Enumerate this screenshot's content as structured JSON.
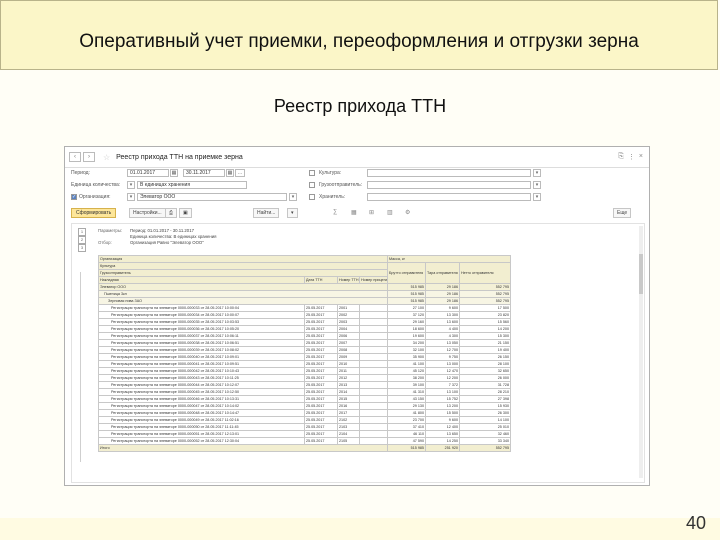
{
  "slide": {
    "title": "Оперативный учет приемки, переоформления и отгрузки зерна",
    "subtitle": "Реестр прихода ТТН",
    "page_number": "40"
  },
  "window": {
    "title": "Реестр прихода ТТН на приемке зерна"
  },
  "filters": {
    "period_label": "Период:",
    "date_from": "01.01.2017",
    "date_to": "30.11.2017",
    "units_label": "Единица количества:",
    "units_value": "В единицах хранения",
    "org_label": "Организация:",
    "org_value": "Элеватор ООО",
    "crop_label": "Культура:",
    "consignor_label": "Грузоотправитель:",
    "owner_label": "Хранитель:"
  },
  "toolbar": {
    "form_button": "Сформировать",
    "variant_button": "Настройки...",
    "find_button": "Найти...",
    "more_button": "Еще"
  },
  "report": {
    "params": [
      {
        "k": "Параметры:",
        "v": "Период: 01.01.2017 - 30.11.2017"
      },
      {
        "k": "",
        "v": "Единица количества: В единицах хранения"
      },
      {
        "k": "Отбор:",
        "v": "Организация Равно \"Элеватор ООО\""
      }
    ],
    "headers": {
      "h1": "Организация",
      "h2": "Культура",
      "h3": "Грузоотправитель",
      "h4": "Накладная",
      "date": "Дата ТТН",
      "num": "Номер ТТН",
      "num2": "Номер прицепа",
      "mass_group": "Масса, кг",
      "gross": "Брутто отправителя",
      "tare": "Тара отправителя",
      "net": "Нетто отправителя"
    },
    "groups": [
      {
        "label": "Элеватор ООО",
        "gross": "515 985",
        "tare": "29 186",
        "net": "552 795"
      },
      {
        "label": "Пшеница 3кл",
        "gross": "515 985",
        "tare": "29 186",
        "net": "552 795"
      },
      {
        "label": "Зерновая нива ЗАО",
        "gross": "515 985",
        "tare": "29 186",
        "net": "552 795"
      }
    ],
    "rows": [
      {
        "doc": "Регистрация транспорта на элеваторе 0000-000033 от 28.05.2017 10:00:04",
        "date": "25.05.2017",
        "num": "2001",
        "gross": "27 100",
        "tare": "9 600",
        "net": "17 500"
      },
      {
        "doc": "Регистрация транспорта на элеваторе 0000-000034 от 28.05.2017 10:00:07",
        "date": "25.05.2017",
        "num": "2002",
        "gross": "37 120",
        "tare": "13 300",
        "net": "23 820"
      },
      {
        "doc": "Регистрация транспорта на элеваторе 0000-000035 от 28.05.2017 10:03:53",
        "date": "25.05.2017",
        "num": "2003",
        "gross": "29 160",
        "tare": "13 600",
        "net": "15 560"
      },
      {
        "doc": "Регистрация транспорта на элеваторе 0000-000036 от 28.05.2017 10:05:20",
        "date": "25.05.2017",
        "num": "2004",
        "gross": "18 600",
        "tare": "4 400",
        "net": "14 200"
      },
      {
        "doc": "Регистрация транспорта на элеваторе 0000-000037 от 28.05.2017 10:06:11",
        "date": "25.05.2017",
        "num": "2006",
        "gross": "19 600",
        "tare": "4 300",
        "net": "15 300"
      },
      {
        "doc": "Регистрация транспорта на элеваторе 0000-000038 от 28.05.2017 10:06:51",
        "date": "25.05.2017",
        "num": "2007",
        "gross": "34 200",
        "tare": "13 050",
        "net": "21 150"
      },
      {
        "doc": "Регистрация транспорта на элеваторе 0000-000039 от 28.05.2017 10:08:02",
        "date": "25.05.2017",
        "num": "2008",
        "gross": "32 100",
        "tare": "12 700",
        "net": "19 400"
      },
      {
        "doc": "Регистрация транспорта на элеваторе 0000-000040 от 28.05.2017 10:09:01",
        "date": "25.05.2017",
        "num": "2009",
        "gross": "35 900",
        "tare": "9 750",
        "net": "26 150"
      },
      {
        "doc": "Регистрация транспорта на элеваторе 0000-000041 от 28.05.2017 10:09:51",
        "date": "25.05.2017",
        "num": "2010",
        "gross": "41 100",
        "tare": "13 000",
        "net": "28 100"
      },
      {
        "doc": "Регистрация транспорта на элеваторе 0000-000042 от 28.05.2017 10:10:43",
        "date": "25.05.2017",
        "num": "2011",
        "gross": "45 120",
        "tare": "12 470",
        "net": "32 650"
      },
      {
        "doc": "Регистрация транспорта на элеваторе 0000-000043 от 28.05.2017 10:11:25",
        "date": "25.05.2017",
        "num": "2012",
        "gross": "38 200",
        "tare": "12 200",
        "net": "26 000"
      },
      {
        "doc": "Регистрация транспорта на элеваторе 0000-000044 от 28.05.2017 10:12:07",
        "date": "25.05.2017",
        "num": "2013",
        "gross": "39 100",
        "tare": "7 372",
        "net": "31 728"
      },
      {
        "doc": "Регистрация транспорта на элеваторе 0000-000045 от 28.05.2017 10:12:50",
        "date": "25.05.2017",
        "num": "2014",
        "gross": "41 310",
        "tare": "13 100",
        "net": "28 210"
      },
      {
        "doc": "Регистрация транспорта на элеваторе 0000-000046 от 28.05.2017 10:13:31",
        "date": "25.05.2017",
        "num": "2015",
        "gross": "43 150",
        "tare": "15 752",
        "net": "27 398"
      },
      {
        "doc": "Регистрация транспорта на элеваторе 0000-000047 от 28.05.2017 10:14:02",
        "date": "25.05.2017",
        "num": "2016",
        "gross": "29 130",
        "tare": "13 200",
        "net": "15 930"
      },
      {
        "doc": "Регистрация транспорта на элеваторе 0000-000048 от 28.05.2017 10:14:47",
        "date": "25.05.2017",
        "num": "2017",
        "gross": "41 800",
        "tare": "15 500",
        "net": "26 300"
      },
      {
        "doc": "Регистрация транспорта на элеваторе 0000-000049 от 28.05.2017 11:02:16",
        "date": "25.05.2017",
        "num": "2102",
        "gross": "23 700",
        "tare": "9 600",
        "net": "14 100"
      },
      {
        "doc": "Регистрация транспорта на элеваторе 0000-000050 от 28.05.2017 11:11:45",
        "date": "25.05.2017",
        "num": "2103",
        "gross": "37 410",
        "tare": "12 400",
        "net": "25 010"
      },
      {
        "doc": "Регистрация транспорта на элеваторе 0000-000051 от 28.05.2017 12:13:01",
        "date": "25.05.2017",
        "num": "2104",
        "gross": "46 110",
        "tare": "13 650",
        "net": "32 460"
      },
      {
        "doc": "Регистрация транспорта на элеваторе 0000-000052 от 28.05.2017 12:30:04",
        "date": "25.05.2017",
        "num": "2105",
        "gross": "47 590",
        "tare": "14 250",
        "net": "33 340"
      }
    ],
    "total": {
      "label": "Итого",
      "gross": "515 985",
      "tare": "251 920",
      "net": "552 795"
    }
  }
}
